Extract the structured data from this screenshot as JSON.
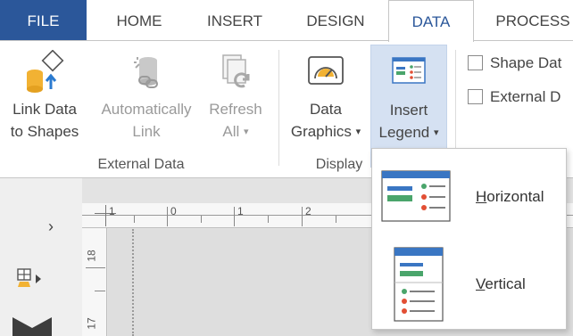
{
  "tabs": {
    "file": "FILE",
    "home": "HOME",
    "insert": "INSERT",
    "design": "DESIGN",
    "data": "DATA",
    "process": "PROCESS"
  },
  "ribbon": {
    "link_data": {
      "line1": "Link Data",
      "line2": "to Shapes"
    },
    "auto_link": {
      "line1": "Automatically",
      "line2": "Link"
    },
    "refresh_all": {
      "line1": "Refresh",
      "line2": "All"
    },
    "data_graphics": {
      "line1": "Data",
      "line2": "Graphics"
    },
    "insert_legend": {
      "line1": "Insert",
      "line2": "Legend"
    },
    "groups": {
      "external_data": "External Data",
      "display": "Display"
    },
    "checkboxes": {
      "shape_data": "Shape Dat",
      "external_data": "External D"
    }
  },
  "rulers": {
    "h": [
      "1",
      "0",
      "1",
      "2"
    ],
    "v": [
      "18",
      "17"
    ]
  },
  "legend_menu": {
    "horizontal": {
      "accel": "H",
      "rest": "orizontal"
    },
    "vertical": {
      "accel": "V",
      "rest": "ertical"
    }
  },
  "colors": {
    "accent": "#2b579a",
    "pressed": "#d5e1f2",
    "legend_blue": "#3a76c3",
    "legend_green": "#4aa56b",
    "legend_red": "#e24f34"
  }
}
